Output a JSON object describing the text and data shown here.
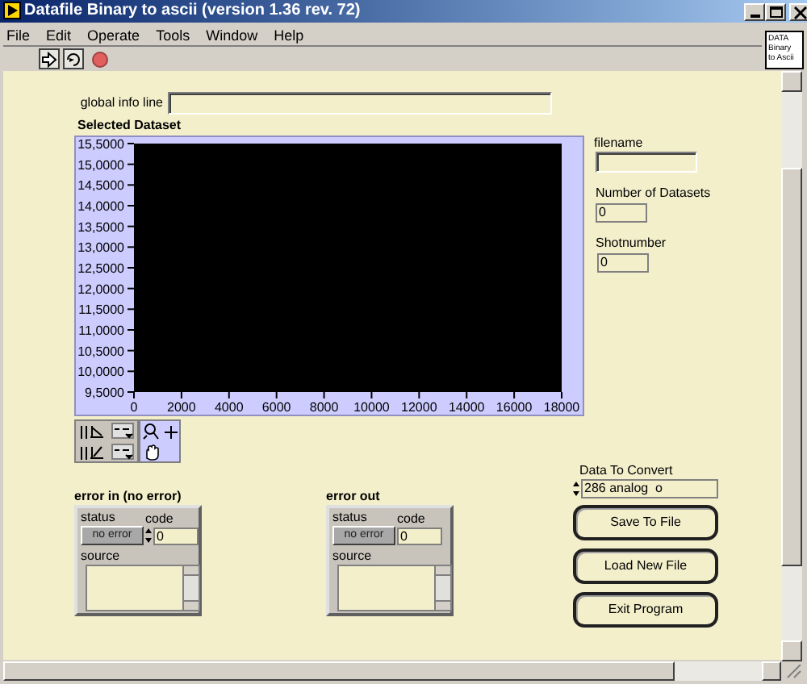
{
  "window": {
    "title": "Datafile Binary to ascii (version 1.36 rev. 72)"
  },
  "menu": [
    "File",
    "Edit",
    "Operate",
    "Tools",
    "Window",
    "Help"
  ],
  "vi_icon": {
    "lines": [
      "DATA",
      "Binary",
      "to Ascii"
    ]
  },
  "global_info_line": {
    "label": "global info line"
  },
  "chart": {
    "label": "Selected Dataset",
    "y_labels": [
      "15,5000",
      "15,0000",
      "14,5000",
      "14,0000",
      "13,5000",
      "13,0000",
      "12,5000",
      "12,0000",
      "11,5000",
      "11,0000",
      "10,5000",
      "10,0000",
      "9,5000"
    ],
    "x_labels": [
      "0",
      "2000",
      "4000",
      "6000",
      "8000",
      "10000",
      "12000",
      "14000",
      "16000",
      "18000"
    ]
  },
  "filename": {
    "label": "filename"
  },
  "number_of_datasets": {
    "label": "Number of Datasets",
    "value": "0"
  },
  "shotnumber": {
    "label": "Shotnumber",
    "value": "0"
  },
  "error_clusters": [
    {
      "title": "error in (no error)",
      "status_label": "status",
      "status": "no error",
      "code_label": "code",
      "code": "0",
      "code_spinner": true,
      "source_label": "source"
    },
    {
      "title": "error out",
      "status_label": "status",
      "status": "no error",
      "code_label": "code",
      "code": "0",
      "code_spinner": false,
      "source_label": "source"
    }
  ],
  "data_to_convert": {
    "label": "Data To Convert",
    "value": "286 analog  o"
  },
  "buttons": [
    "Save To File",
    "Load New File",
    "Exit Program"
  ]
}
